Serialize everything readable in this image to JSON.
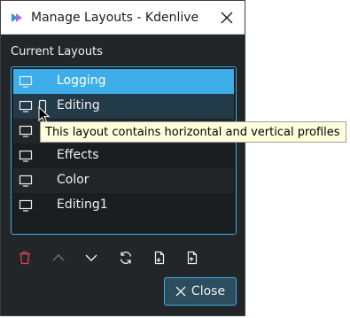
{
  "window": {
    "title": "Manage Layouts - Kdenlive",
    "app_icon": "kdenlive-icon",
    "close_icon": "close-icon"
  },
  "section_label": "Current Layouts",
  "layouts": [
    {
      "label": "Logging",
      "icon": "monitor-icon",
      "state": "selected"
    },
    {
      "label": "Editing",
      "icon": "monitor-icon",
      "extra_icon": "phone-icon",
      "state": "hovered"
    },
    {
      "label": "",
      "icon": "monitor-icon",
      "state": "obscured"
    },
    {
      "label": "Effects",
      "icon": "monitor-icon",
      "state": "normal"
    },
    {
      "label": "Color",
      "icon": "monitor-icon",
      "state": "normal"
    },
    {
      "label": "Editing1",
      "icon": "monitor-icon",
      "state": "normal"
    }
  ],
  "tooltip": "This layout contains horizontal and vertical profiles",
  "toolbar": {
    "delete_icon": "trash-icon",
    "move_up_icon": "chevron-up-icon",
    "move_down_icon": "chevron-down-icon",
    "reset_icon": "refresh-icon",
    "import_icon": "import-file-icon",
    "export_icon": "export-file-icon"
  },
  "close_button": {
    "label": "Close",
    "icon": "close-icon"
  },
  "colors": {
    "accent": "#3daee9",
    "delete": "#da4453",
    "background": "#232629"
  }
}
